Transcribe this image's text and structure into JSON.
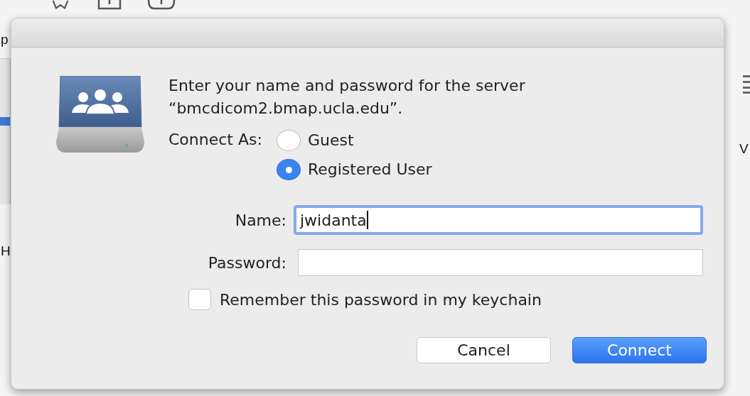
{
  "background": {
    "fragments": [
      "p",
      "H",
      "V"
    ]
  },
  "dialog": {
    "message": "Enter your name and password for the server\n“bmcdicom2.bmap.ucla.edu”.",
    "connect_as_label": "Connect As:",
    "options": [
      {
        "label": "Guest",
        "selected": false
      },
      {
        "label": "Registered User",
        "selected": true
      }
    ],
    "fields": [
      {
        "label": "Name:",
        "value": "jwidanta",
        "focused": true
      },
      {
        "label": "Password:",
        "focused": false
      }
    ],
    "remember": {
      "label": "Remember this password in my keychain",
      "checked": false
    },
    "buttons": [
      {
        "label": "Cancel",
        "kind": "secondary"
      },
      {
        "label": "Connect",
        "kind": "primary"
      }
    ]
  }
}
